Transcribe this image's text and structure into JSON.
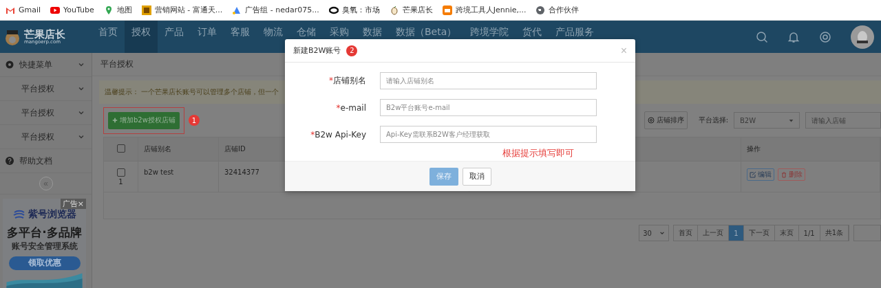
{
  "bookmarks": [
    {
      "label": "Gmail",
      "kind": "gmail"
    },
    {
      "label": "YouTube",
      "kind": "youtube"
    },
    {
      "label": "地图",
      "kind": "pin"
    },
    {
      "label": "营销网站 - 富通天...",
      "kind": "site"
    },
    {
      "label": "广告组 - nedar075...",
      "kind": "ads"
    },
    {
      "label": "臭氧：市场",
      "kind": "ring"
    },
    {
      "label": "芒果店长",
      "kind": "mango"
    },
    {
      "label": "跨境工具人Jennie,...",
      "kind": "tool"
    },
    {
      "label": "合作伙伴",
      "kind": "globe"
    }
  ],
  "app": {
    "logo": "芒果店长",
    "logo_sub": "mangoerp.com"
  },
  "nav": [
    {
      "label": "首页",
      "selected": false
    },
    {
      "label": "授权",
      "selected": true
    },
    {
      "label": "产品",
      "selected": false
    },
    {
      "label": "订单",
      "selected": false
    },
    {
      "label": "客服",
      "selected": false
    },
    {
      "label": "物流",
      "selected": false
    },
    {
      "label": "仓储",
      "selected": false
    },
    {
      "label": "采购",
      "selected": false
    },
    {
      "label": "数据",
      "selected": false
    },
    {
      "label": "数据（Beta）",
      "selected": false
    },
    {
      "label": "跨境学院",
      "selected": false
    },
    {
      "label": "货代",
      "selected": false
    },
    {
      "label": "产品服务",
      "selected": false
    }
  ],
  "sidebar": {
    "items": [
      {
        "label": "快捷菜单",
        "kind": "menu"
      },
      {
        "label": "平台授权",
        "kind": "sub"
      },
      {
        "label": "平台授权",
        "kind": "sub"
      },
      {
        "label": "平台授权",
        "kind": "sub"
      },
      {
        "label": "帮助文档",
        "kind": "help"
      }
    ],
    "collapse": "«",
    "ad": {
      "tag": "广告×",
      "brand": "紫号浏览器",
      "headline": "多平台·多品牌",
      "subline": "账号安全管理系统",
      "cta": "领取优惠"
    }
  },
  "breadcrumb": "平台授权",
  "notice": "温馨提示： 一个芒果店长账号可以管理多个店铺，但一个",
  "toolbar": {
    "add_button": "增加b2w授权店铺",
    "add_badge": "1",
    "sort_button": "店铺排序",
    "platform_label": "平台选择:",
    "platform_value": "B2W",
    "search_placeholder": "请输入店铺"
  },
  "table": {
    "select_all_checked": false,
    "columns": [
      "店铺别名",
      "店铺ID",
      "操作"
    ],
    "rows": [
      {
        "checked": false,
        "index": "1",
        "cells": [
          "b2w test",
          "32414377"
        ],
        "actions": [
          "编辑",
          "删除"
        ]
      }
    ]
  },
  "pagination": {
    "page_size": "30",
    "items": [
      {
        "label": "首页",
        "selected": false
      },
      {
        "label": "上一页",
        "selected": false
      },
      {
        "label": "1",
        "selected": true
      },
      {
        "label": "下一页",
        "selected": false
      },
      {
        "label": "末页",
        "selected": false
      },
      {
        "label": "1/1",
        "selected": false
      },
      {
        "label": "共1条",
        "selected": false
      }
    ]
  },
  "modal": {
    "title": "新建B2W账号",
    "badge": "2",
    "close": "×",
    "required_mark": "*",
    "fields": [
      {
        "label": "店铺别名",
        "required": true,
        "placeholder": "请输入店铺别名"
      },
      {
        "label": "e-mail",
        "required": true,
        "placeholder": "B2w平台账号e-mail"
      },
      {
        "label": "B2w Api-Key",
        "required": true,
        "placeholder": "Api-Key需联系B2W客户经理获取"
      }
    ],
    "hint": "根据提示填写即可",
    "buttons": [
      {
        "label": "保存",
        "kind": "primary",
        "disabled": true
      },
      {
        "label": "取消",
        "kind": "default",
        "disabled": false
      }
    ]
  }
}
